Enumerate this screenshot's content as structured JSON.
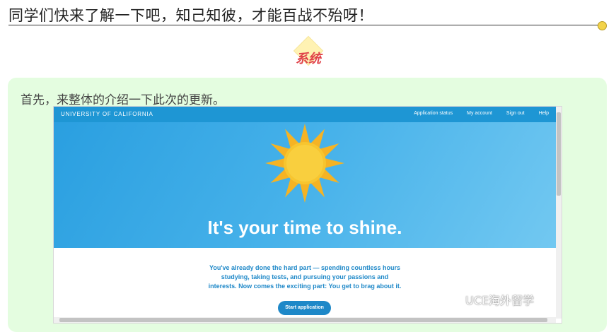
{
  "article": {
    "headline": "同学们快来了解一下吧，知己知彼，才能百战不殆呀！",
    "section_badge": "系统",
    "intro": "首先，来整体的介绍一下此次的更新。"
  },
  "screenshot": {
    "brand": "UNIVERSITY OF CALIFORNIA",
    "nav": [
      "Application status",
      "My account",
      "Sign out",
      "Help"
    ],
    "hero_title": "It's your time to shine.",
    "body_lines": [
      "You've already done the hard part — spending countless hours",
      "studying, taking tests, and pursuing your passions and",
      "interests. Now comes the exciting part: You get to brag about it."
    ],
    "start_button": "Start application"
  },
  "watermark": "UCE海外留学",
  "colors": {
    "nav_blue": "#1e96d4",
    "hero_blue": "#47b2ea",
    "sun": "#f7b928",
    "badge_red": "#e0434a",
    "panel_green": "#e4fde0"
  },
  "icons": {
    "watermark": "wechat-icon",
    "hero": "sun-icon"
  }
}
